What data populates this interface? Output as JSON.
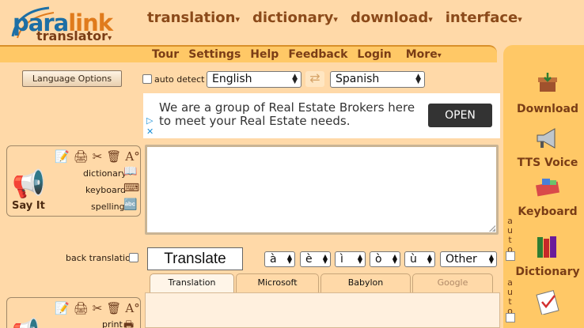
{
  "logo": {
    "brand_blue": "para",
    "brand_orange": "link",
    "product": "translator"
  },
  "main_nav": [
    {
      "label": "translation"
    },
    {
      "label": "dictionary"
    },
    {
      "label": "download"
    },
    {
      "label": "interface"
    }
  ],
  "nav_arrow": "▾",
  "sub_nav": {
    "tour": "Tour",
    "settings": "Settings",
    "help": "Help",
    "feedback": "Feedback",
    "login": "Login",
    "more": "More"
  },
  "controls": {
    "language_options": "Language Options",
    "auto_detect": "auto detect",
    "source_language": "English",
    "target_language": "Spanish"
  },
  "ad": {
    "text": "We are a group of Real Estate Brokers here to meet your Real Estate needs.",
    "cta": "OPEN"
  },
  "say_it_panel": {
    "label": "Say It",
    "dictionary": "dictionary",
    "keyboard": "keyboard",
    "spelling": "spelling"
  },
  "back_translation": "back translation",
  "translate_button": "Translate",
  "special_chars": [
    "à",
    "è",
    "ì",
    "ò",
    "ù"
  ],
  "other_label": "Other",
  "output_tabs": [
    {
      "label": "Translation"
    },
    {
      "label": "Microsoft"
    },
    {
      "label": "Babylon"
    },
    {
      "label": "Google"
    }
  ],
  "second_panel": {
    "print": "print"
  },
  "right_tools": {
    "download": "Download",
    "tts": "TTS Voice",
    "keyboard": "Keyboard",
    "dictionary": "Dictionary"
  },
  "auto_vertical": "auto",
  "colors": {
    "background": "#ffd9a8",
    "bar": "#ffc866",
    "brand_blue": "#1d6fa5",
    "brand_orange": "#e07b1c",
    "nav_text": "#8b4a1a"
  }
}
